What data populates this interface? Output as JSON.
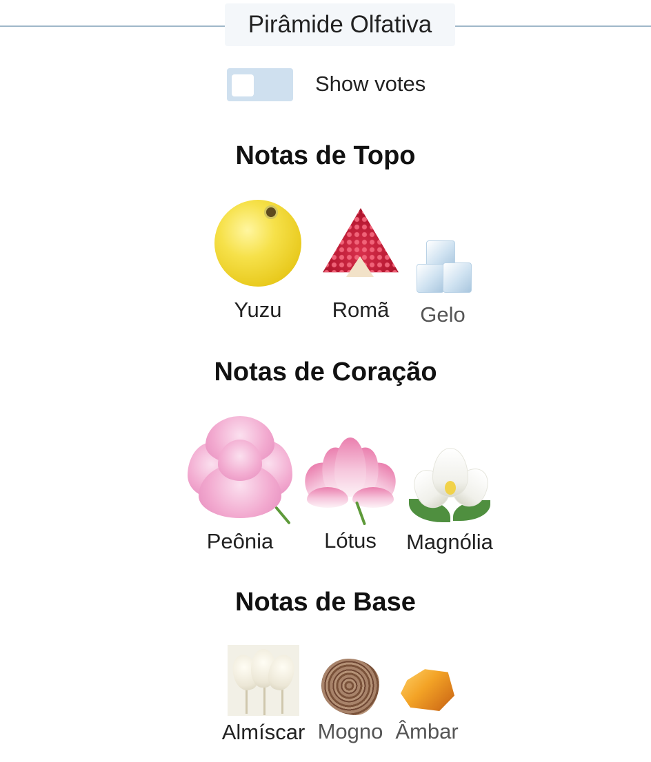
{
  "header": {
    "title": "Pirâmide Olfativa"
  },
  "toggle": {
    "label": "Show votes",
    "checked": false
  },
  "sections": {
    "top": {
      "title": "Notas de Topo",
      "notes": [
        {
          "name": "Yuzu",
          "icon": "yuzu-icon"
        },
        {
          "name": "Romã",
          "icon": "pomegranate-icon"
        },
        {
          "name": "Gelo",
          "icon": "ice-icon"
        }
      ]
    },
    "heart": {
      "title": "Notas de Coração",
      "notes": [
        {
          "name": "Peônia",
          "icon": "peony-icon"
        },
        {
          "name": "Lótus",
          "icon": "lotus-icon"
        },
        {
          "name": "Magnólia",
          "icon": "magnolia-icon"
        }
      ]
    },
    "base": {
      "title": "Notas de Base",
      "notes": [
        {
          "name": "Almíscar",
          "icon": "musk-icon"
        },
        {
          "name": "Mogno",
          "icon": "mahogany-icon"
        },
        {
          "name": "Âmbar",
          "icon": "amber-icon"
        }
      ]
    }
  },
  "colors": {
    "header_line": "#9fb7c9",
    "toggle_bg": "#cfe0ef",
    "header_bg": "#f4f7fa"
  }
}
